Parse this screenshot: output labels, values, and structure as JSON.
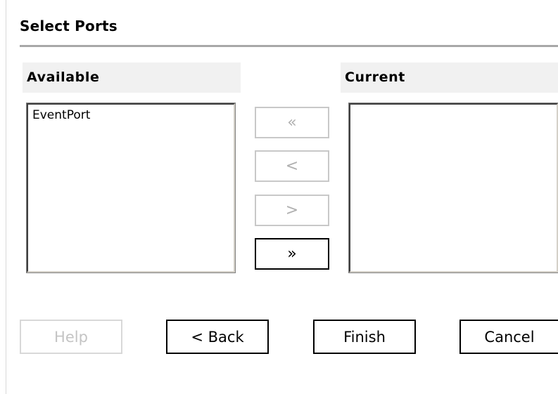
{
  "dialog": {
    "title": "Select Ports"
  },
  "available": {
    "header": "Available",
    "items": [
      "EventPort"
    ]
  },
  "current": {
    "header": "Current",
    "items": []
  },
  "move_buttons": {
    "remove_all": {
      "label": "«",
      "enabled": false
    },
    "remove": {
      "label": "<",
      "enabled": false
    },
    "add": {
      "label": ">",
      "enabled": false
    },
    "add_all": {
      "label": "»",
      "enabled": true
    }
  },
  "footer": {
    "help": {
      "label": "Help",
      "enabled": false
    },
    "back": {
      "label": "< Back",
      "enabled": true
    },
    "finish": {
      "label": "Finish",
      "enabled": true
    },
    "cancel": {
      "label": "Cancel",
      "enabled": true
    }
  },
  "colors": {
    "header_bg": "#f1f1f1",
    "disabled_border": "#c8c8c8",
    "disabled_text": "#b0b0b0",
    "enabled_border": "#000000"
  }
}
